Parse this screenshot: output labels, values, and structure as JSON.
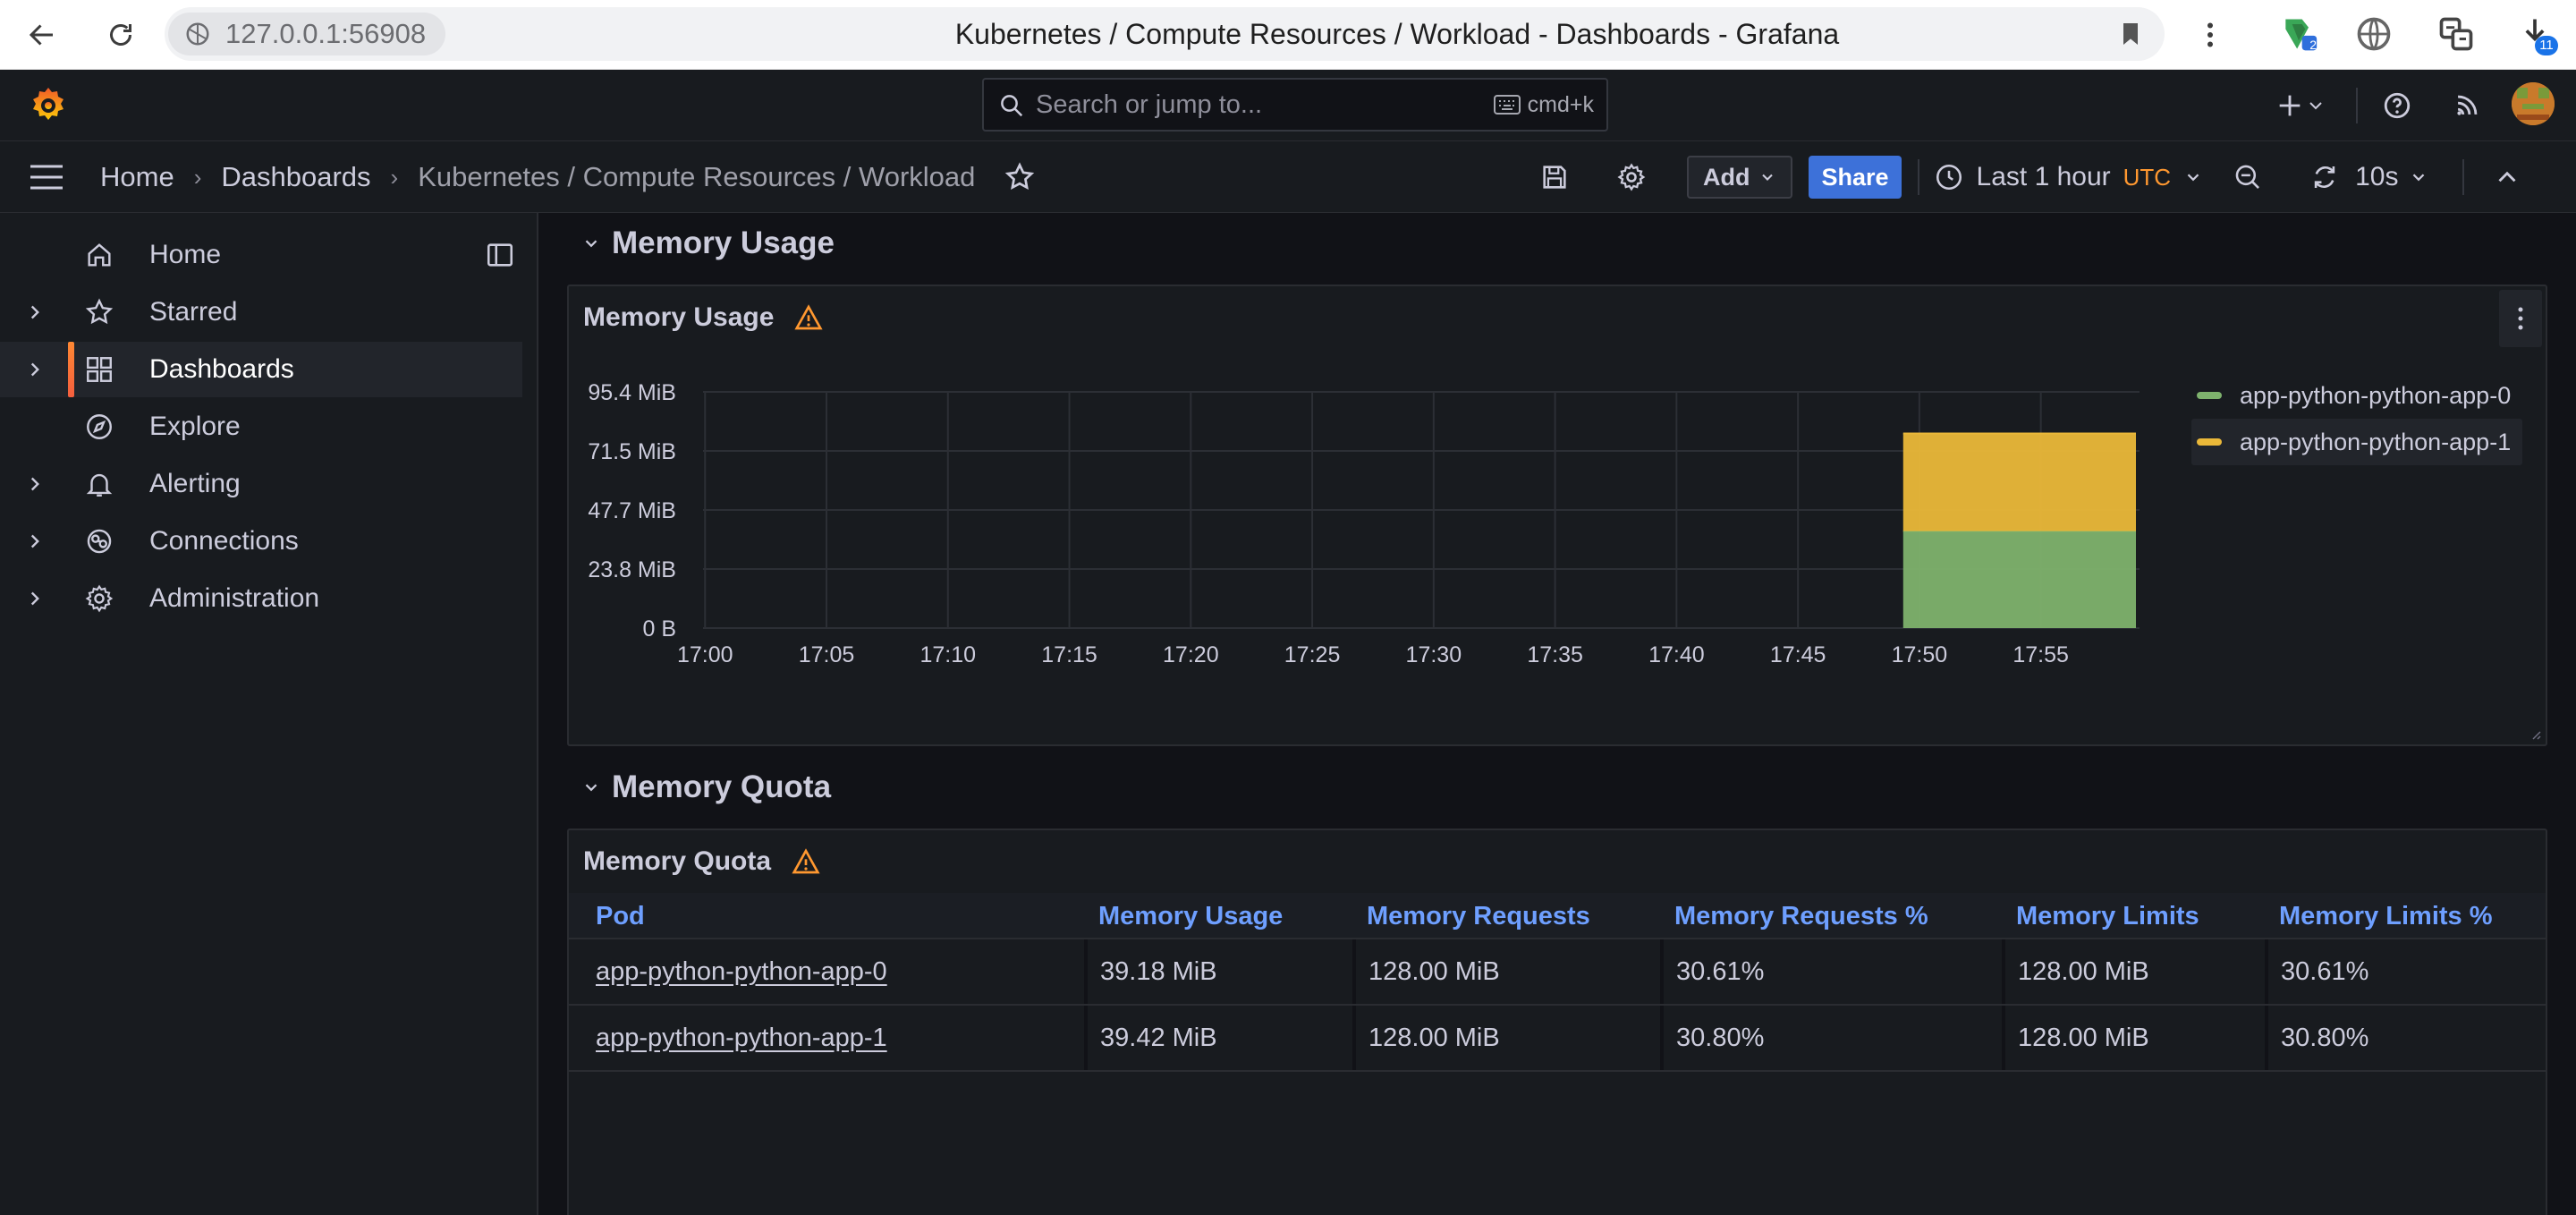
{
  "browser": {
    "url": "127.0.0.1:56908",
    "page_title": "Kubernetes / Compute Resources / Workload - Dashboards - Grafana",
    "extension_badge": "11",
    "ext_badge_2": "2"
  },
  "topbar": {
    "search_placeholder": "Search or jump to...",
    "search_shortcut": "cmd+k"
  },
  "breadcrumb": {
    "items": [
      "Home",
      "Dashboards",
      "Kubernetes / Compute Resources / Workload"
    ]
  },
  "toolbar": {
    "add_label": "Add",
    "share_label": "Share",
    "time_range": "Last 1 hour",
    "timezone": "UTC",
    "refresh_interval": "10s"
  },
  "sidebar": {
    "items": [
      {
        "label": "Home",
        "icon": "home-icon",
        "expandable": false
      },
      {
        "label": "Starred",
        "icon": "star-icon",
        "expandable": true
      },
      {
        "label": "Dashboards",
        "icon": "apps-icon",
        "expandable": true,
        "active": true
      },
      {
        "label": "Explore",
        "icon": "compass-icon",
        "expandable": false
      },
      {
        "label": "Alerting",
        "icon": "bell-icon",
        "expandable": true
      },
      {
        "label": "Connections",
        "icon": "connections-icon",
        "expandable": true
      },
      {
        "label": "Administration",
        "icon": "cog-icon",
        "expandable": true
      }
    ]
  },
  "rows": {
    "memory_usage": "Memory Usage",
    "memory_quota": "Memory Quota"
  },
  "usage_panel": {
    "title": "Memory Usage"
  },
  "quota_panel": {
    "title": "Memory Quota",
    "columns": [
      "Pod",
      "Memory Usage",
      "Memory Requests",
      "Memory Requests %",
      "Memory Limits",
      "Memory Limits %"
    ],
    "rows": [
      [
        "app-python-python-app-0",
        "39.18 MiB",
        "128.00 MiB",
        "30.61%",
        "128.00 MiB",
        "30.61%"
      ],
      [
        "app-python-python-app-1",
        "39.42 MiB",
        "128.00 MiB",
        "30.80%",
        "128.00 MiB",
        "30.80%"
      ]
    ]
  },
  "chart_data": {
    "type": "area",
    "stacked": true,
    "title": "Memory Usage",
    "x": [
      "17:00",
      "17:05",
      "17:10",
      "17:15",
      "17:20",
      "17:25",
      "17:30",
      "17:35",
      "17:40",
      "17:45",
      "17:50",
      "17:55"
    ],
    "x_range": [
      "16:59:55",
      "17:58:55"
    ],
    "y_ticks": [
      "0 B",
      "23.8 MiB",
      "47.7 MiB",
      "71.5 MiB",
      "95.4 MiB"
    ],
    "ylim_mib": [
      0,
      95.4
    ],
    "series": [
      {
        "name": "app-python-python-app-0",
        "color": "#7eb26d",
        "points": [
          [
            "17:49:20",
            39.18
          ],
          [
            "17:58:55",
            39.18
          ]
        ]
      },
      {
        "name": "app-python-python-app-1",
        "color": "#eab839",
        "points": [
          [
            "17:49:20",
            39.42
          ],
          [
            "17:58:55",
            39.42
          ]
        ]
      }
    ],
    "grid": true,
    "legend": "right"
  }
}
